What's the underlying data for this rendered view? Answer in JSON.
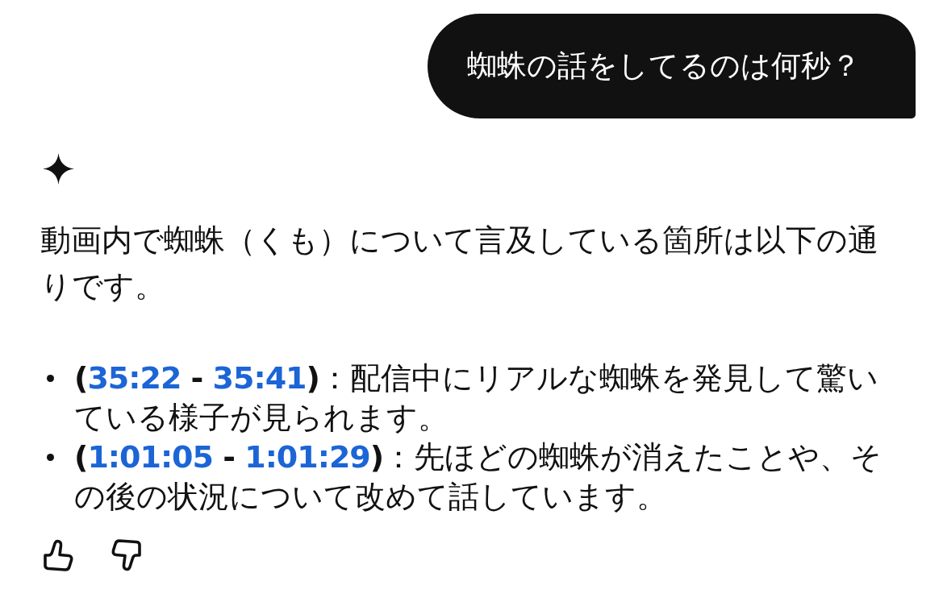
{
  "user_message": {
    "text": "蜘蛛の話をしてるのは何秒？"
  },
  "response": {
    "intro": "動画内で蜘蛛（くも）について言及している箇所は以下の通りです。",
    "items": [
      {
        "open": "(",
        "start": "35:22",
        "separator": "-",
        "end": "35:41",
        "close": ")",
        "description": "：配信中にリアルな蜘蛛を発見して驚いている様子が見られます。"
      },
      {
        "open": "(",
        "start": "1:01:05",
        "separator": "-",
        "end": "1:01:29",
        "close": ")",
        "description": "：先ほどの蜘蛛が消えたことや、その後の状況について改めて話しています。"
      }
    ]
  }
}
